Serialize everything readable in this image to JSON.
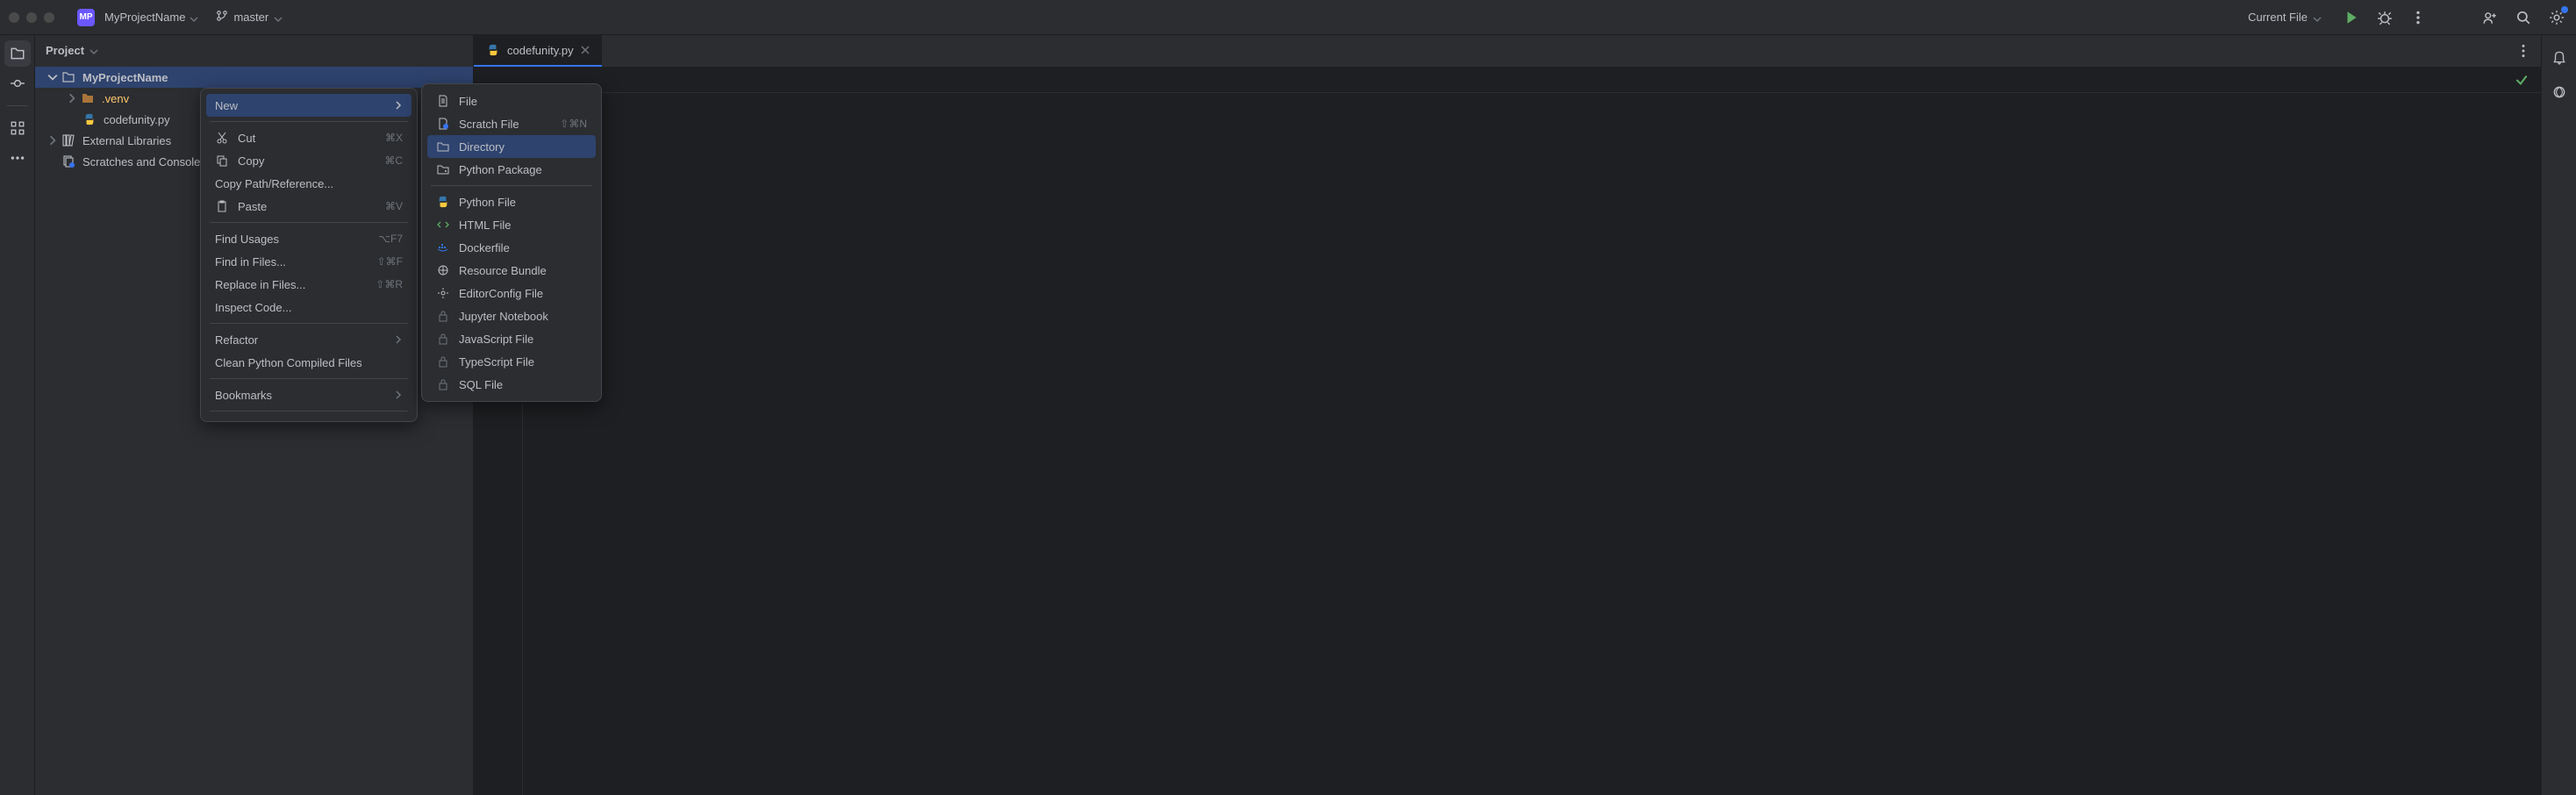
{
  "titlebar": {
    "project_badge": "MP",
    "project_name": "MyProjectName",
    "branch": "master",
    "config": "Current File"
  },
  "project_panel": {
    "header": "Project",
    "root": "MyProjectName",
    "venv": ".venv",
    "file1": "codefunity.py",
    "external": "External Libraries",
    "scratches": "Scratches and Consoles"
  },
  "tab": {
    "filename": "codefunity.py"
  },
  "context_menu": {
    "new": "New",
    "cut": "Cut",
    "cut_sc": "⌘X",
    "copy": "Copy",
    "copy_sc": "⌘C",
    "copy_path": "Copy Path/Reference...",
    "paste": "Paste",
    "paste_sc": "⌘V",
    "find_usages": "Find Usages",
    "find_usages_sc": "⌥F7",
    "find_in_files": "Find in Files...",
    "find_in_files_sc": "⇧⌘F",
    "replace_in_files": "Replace in Files...",
    "replace_in_files_sc": "⇧⌘R",
    "inspect_code": "Inspect Code...",
    "refactor": "Refactor",
    "clean_python": "Clean Python Compiled Files",
    "bookmarks": "Bookmarks"
  },
  "submenu": {
    "file": "File",
    "scratch_file": "Scratch File",
    "scratch_file_sc": "⇧⌘N",
    "directory": "Directory",
    "python_package": "Python Package",
    "python_file": "Python File",
    "html_file": "HTML File",
    "dockerfile": "Dockerfile",
    "resource_bundle": "Resource Bundle",
    "editorconfig": "EditorConfig File",
    "jupyter": "Jupyter Notebook",
    "javascript": "JavaScript File",
    "typescript": "TypeScript File",
    "sql": "SQL File"
  }
}
